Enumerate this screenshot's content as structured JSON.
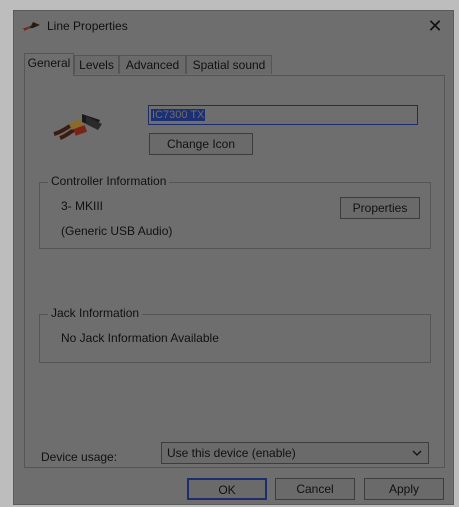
{
  "window": {
    "title": "Line Properties",
    "close_glyph": "✕",
    "icon": "speaker-cable-icon"
  },
  "tabs": [
    {
      "label": "General",
      "active": true
    },
    {
      "label": "Levels",
      "active": false
    },
    {
      "label": "Advanced",
      "active": false
    },
    {
      "label": "Spatial sound",
      "active": false
    }
  ],
  "general": {
    "device_name": "IC7300 TX",
    "device_icon": "rca-cable-icon",
    "change_icon_button": "Change Icon",
    "controller": {
      "title": "Controller Information",
      "name": "3- MKIII",
      "driver": "(Generic USB Audio)",
      "properties_button": "Properties"
    },
    "jack": {
      "title": "Jack Information",
      "text": "No Jack Information Available"
    },
    "device_usage": {
      "label": "Device usage:",
      "selected": "Use this device (enable)"
    }
  },
  "footer": {
    "ok": "OK",
    "cancel": "Cancel",
    "apply": "Apply"
  },
  "colors": {
    "background": "#6e6e6e",
    "focus_border": "#1b2d6b",
    "selection": "#1c2f72"
  }
}
